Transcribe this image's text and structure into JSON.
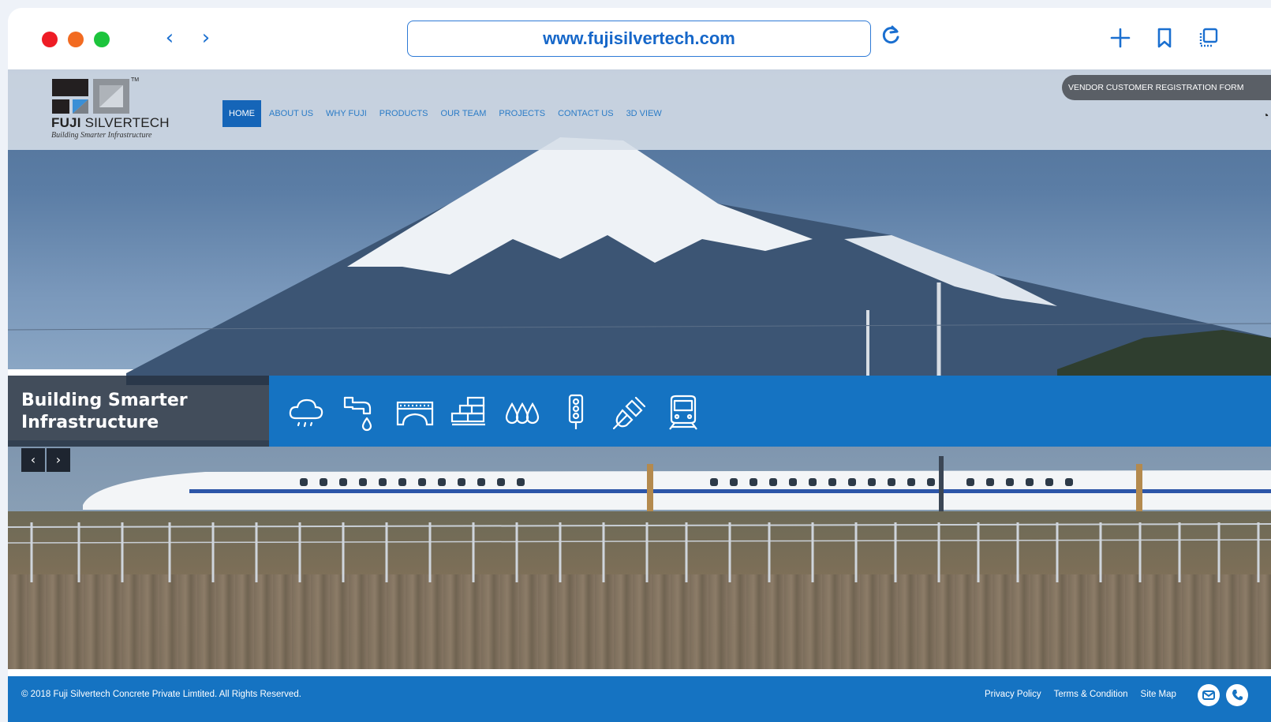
{
  "browser": {
    "url": "www.fujisilvertech.com",
    "icons": [
      "chevron-left-icon",
      "chevron-right-icon",
      "reload-icon",
      "plus-icon",
      "bookmark-icon",
      "tabs-icon"
    ],
    "accent": "#1a6fd0"
  },
  "site": {
    "logo": {
      "brand_bold": "FUJI",
      "brand_rest": "SILVERTECH",
      "tm": "TM",
      "tagline": "Building Smarter Infrastructure"
    },
    "nav": [
      {
        "label": "HOME",
        "active": true
      },
      {
        "label": "ABOUT US",
        "active": false
      },
      {
        "label": "WHY FUJI",
        "active": false
      },
      {
        "label": "PRODUCTS",
        "active": false
      },
      {
        "label": "OUR TEAM",
        "active": false
      },
      {
        "label": "PROJECTS",
        "active": false
      },
      {
        "label": "CONTACT US",
        "active": false
      },
      {
        "label": "3D VIEW",
        "active": false
      }
    ],
    "vendor_button": "VENDOR CUSTOMER REGISTRATION FORM",
    "hero": {
      "caption": "Building Smarter Infrastructure",
      "category_icons": [
        "rain-cloud-icon",
        "water-tap-icon",
        "bridge-icon",
        "brick-wall-icon",
        "water-drops-icon",
        "traffic-light-icon",
        "power-plug-icon",
        "train-icon"
      ],
      "slider_prev": "‹",
      "slider_next": "›"
    },
    "footer": {
      "copyright": "© 2018 Fuji Silvertech Concrete Private Limtited. All Rights Reserved.",
      "links": [
        "Privacy Policy",
        "Terms & Condition",
        "Site Map"
      ]
    },
    "colors": {
      "primary_blue": "#1573c2",
      "nav_active": "#1565b8"
    }
  }
}
